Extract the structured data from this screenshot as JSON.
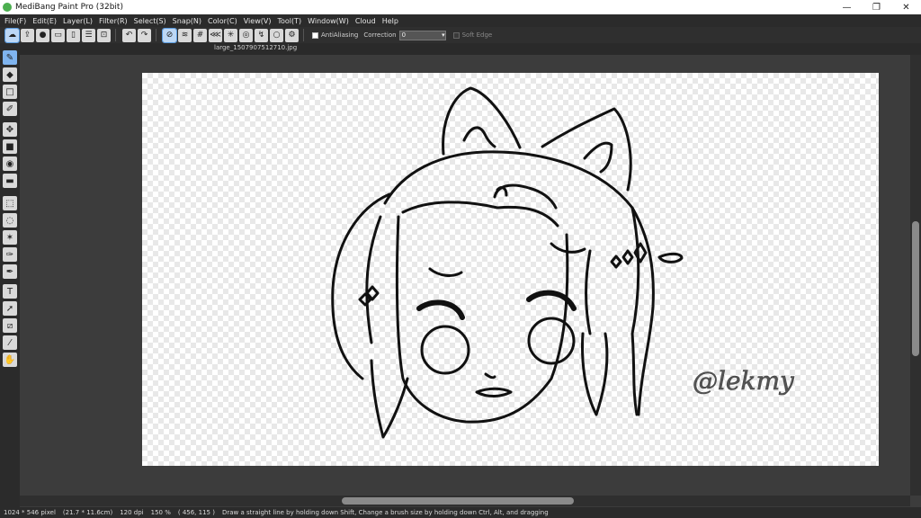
{
  "window": {
    "title": "MediBang Paint Pro (32bit)",
    "minimize": "—",
    "maximize": "❐",
    "close": "✕"
  },
  "menu": [
    "File(F)",
    "Edit(E)",
    "Layer(L)",
    "Filter(R)",
    "Select(S)",
    "Snap(N)",
    "Color(C)",
    "View(V)",
    "Tool(T)",
    "Window(W)",
    "Cloud",
    "Help"
  ],
  "toolbar": {
    "antialiasing_label": "AntiAliasing",
    "correction_label": "Correction",
    "correction_value": "0",
    "soft_edge_label": "Soft Edge"
  },
  "document": {
    "tab_name": "large_1507907512710.jpg"
  },
  "tools": [
    {
      "name": "brush-tool",
      "glyph": "✎",
      "active": true
    },
    {
      "name": "eraser-tool",
      "glyph": "◆",
      "active": false
    },
    {
      "name": "shape-tool",
      "glyph": "□",
      "active": false
    },
    {
      "name": "dot-tool",
      "glyph": "✐",
      "active": false
    },
    {
      "name": "move-tool",
      "glyph": "✥",
      "active": false
    },
    {
      "name": "fill-rect-tool",
      "glyph": "■",
      "active": false
    },
    {
      "name": "bucket-tool",
      "glyph": "◉",
      "active": false
    },
    {
      "name": "gradient-tool",
      "glyph": "▬",
      "active": false
    },
    {
      "name": "select-rect-tool",
      "glyph": "⬚",
      "active": false
    },
    {
      "name": "lasso-tool",
      "glyph": "◌",
      "active": false
    },
    {
      "name": "magic-wand-tool",
      "glyph": "✶",
      "active": false
    },
    {
      "name": "select-pen-tool",
      "glyph": "✑",
      "active": false
    },
    {
      "name": "select-eraser-tool",
      "glyph": "✒",
      "active": false
    },
    {
      "name": "text-tool",
      "glyph": "T",
      "active": false
    },
    {
      "name": "operation-tool",
      "glyph": "➚",
      "active": false
    },
    {
      "name": "divide-tool",
      "glyph": "⧄",
      "active": false
    },
    {
      "name": "eyedropper-tool",
      "glyph": "⁄",
      "active": false
    },
    {
      "name": "hand-tool",
      "glyph": "✋",
      "active": false
    }
  ],
  "status": {
    "size": "1024 * 546 pixel",
    "physical": "(21.7 * 11.6cm)",
    "dpi": "120 dpi",
    "zoom": "150 %",
    "coords": "( 456, 115 )",
    "hint": "Draw a straight line by holding down Shift, Change a brush size by holding down Ctrl, Alt, and dragging"
  },
  "artwork": {
    "signature": "@lekmy"
  },
  "colors": {
    "accent": "#7fb4ef",
    "stroke": "#111111"
  }
}
